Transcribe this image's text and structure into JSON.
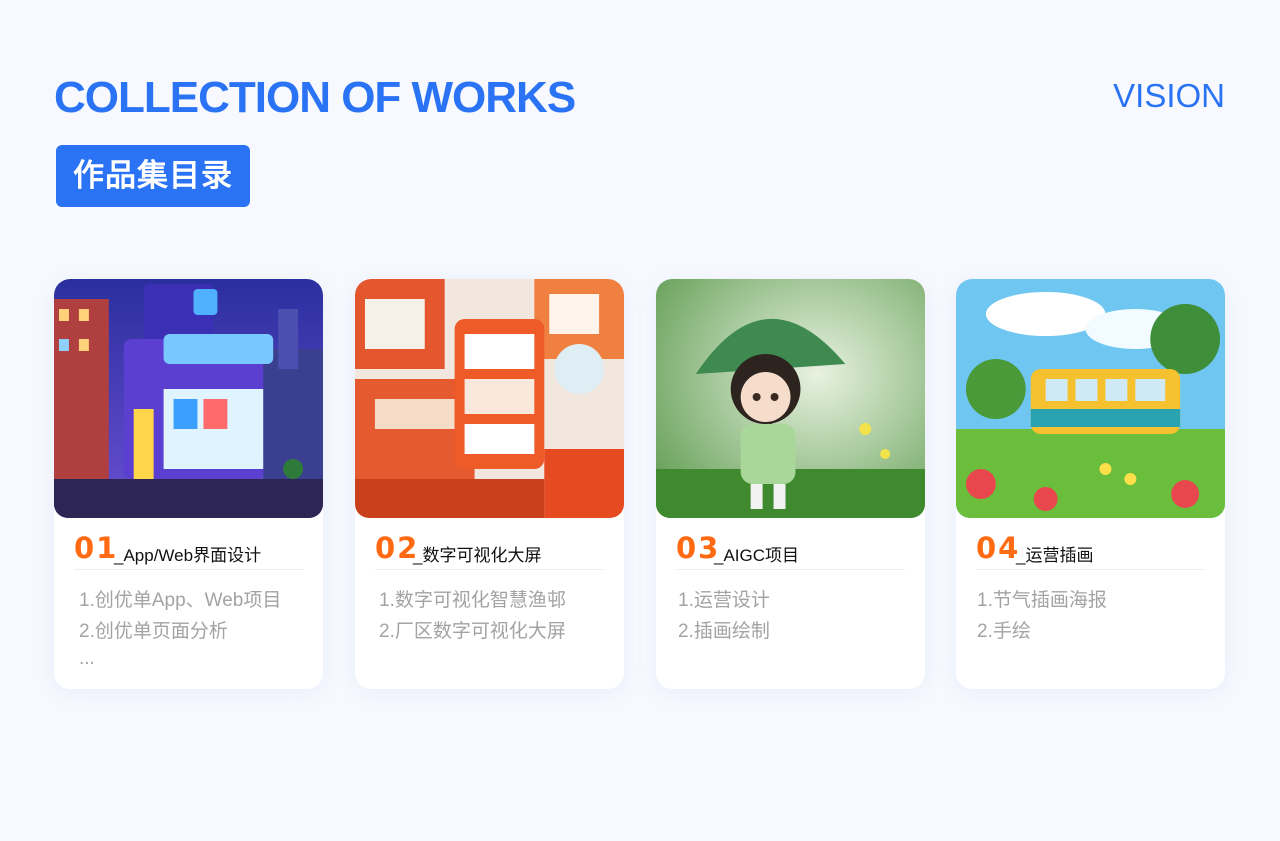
{
  "header": {
    "title": "COLLECTION OF WORKS",
    "vision": "VISION",
    "badge": "作品集目录"
  },
  "colors": {
    "accent": "#2a73f5",
    "number": "#ff6a12",
    "muted": "#a3a3a3"
  },
  "cards": [
    {
      "num": "01",
      "category": "_App/Web界面设计",
      "items": [
        "1.创优单App、Web项目",
        "2.创优单页面分析",
        "..."
      ]
    },
    {
      "num": "02",
      "category": "_数字可视化大屏",
      "items": [
        "1.数字可视化智慧渔邨",
        "2.厂区数字可视化大屏"
      ]
    },
    {
      "num": "03",
      "category": "_AIGC项目",
      "items": [
        "1.运营设计",
        "2.插画绘制"
      ]
    },
    {
      "num": "04",
      "category": "_运营插画",
      "items": [
        "1.节气插画海报",
        "2.手绘"
      ]
    }
  ]
}
